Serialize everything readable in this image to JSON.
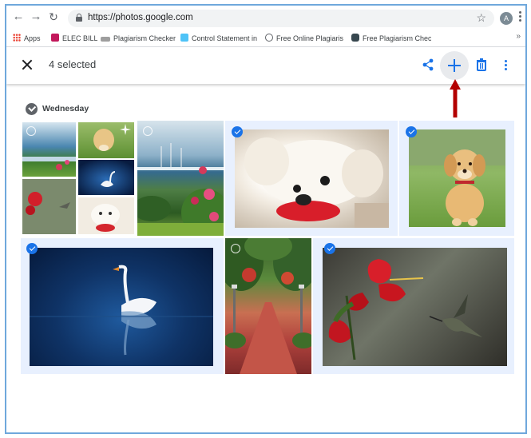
{
  "browser": {
    "url": "https://photos.google.com",
    "avatar_letter": "A",
    "bookmarks": [
      {
        "label": "Apps",
        "icon": "apps-grid-icon"
      },
      {
        "label": "ELEC BILL",
        "icon": "site-favicon-icon"
      },
      {
        "label": "Plagiarism Checker",
        "icon": "site-favicon-icon"
      },
      {
        "label": "Control Statement in",
        "icon": "site-favicon-icon"
      },
      {
        "label": "Free Online Plagiaris",
        "icon": "site-favicon-icon"
      },
      {
        "label": "Free Plagiarism Chec",
        "icon": "site-favicon-icon"
      }
    ],
    "overflow": "»"
  },
  "appbar": {
    "selection_count": "4 selected",
    "actions": [
      "share-icon",
      "add-icon",
      "trash-icon",
      "more-vert-icon"
    ],
    "accent": "#1a73e8"
  },
  "section": {
    "day_label": "Wednesday"
  },
  "photos": [
    {
      "name": "collage",
      "selected": false
    },
    {
      "name": "lake-flowers",
      "selected": false
    },
    {
      "name": "white-dog",
      "selected": true
    },
    {
      "name": "golden-puppy",
      "selected": true
    },
    {
      "name": "swan",
      "selected": true
    },
    {
      "name": "tree-path",
      "selected": false
    },
    {
      "name": "hummingbird-flower",
      "selected": true
    }
  ],
  "annotation": {
    "arrow_color": "#b30000"
  }
}
